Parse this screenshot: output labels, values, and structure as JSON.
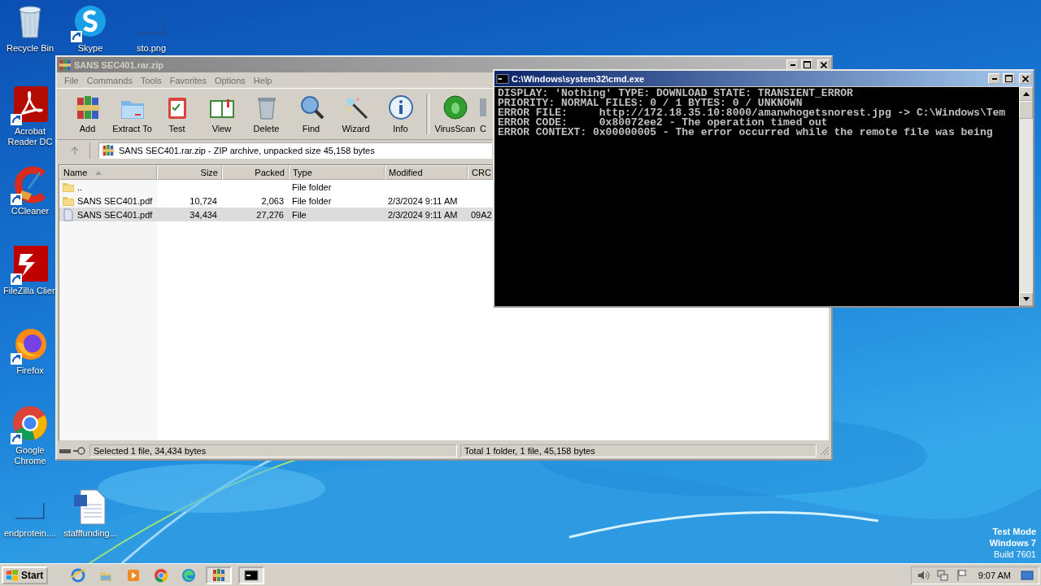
{
  "desktop_icons": [
    {
      "label": "Recycle Bin",
      "kind": "recycle",
      "shortcut": false
    },
    {
      "label": "Skype",
      "kind": "skype",
      "shortcut": true
    },
    {
      "label": "sto.png",
      "kind": "blank",
      "shortcut": false
    },
    {
      "label": "Acrobat Reader DC",
      "kind": "acrobat",
      "shortcut": true
    },
    {
      "label": "CCleaner",
      "kind": "ccleaner",
      "shortcut": true
    },
    {
      "label": "FileZilla Clien",
      "kind": "filezilla",
      "shortcut": true
    },
    {
      "label": "Firefox",
      "kind": "firefox",
      "shortcut": true
    },
    {
      "label": "Google Chrome",
      "kind": "chrome",
      "shortcut": true
    },
    {
      "label": "endprotein....",
      "kind": "blank",
      "shortcut": false
    },
    {
      "label": "stafffunding...",
      "kind": "word",
      "shortcut": false
    }
  ],
  "winrar": {
    "title": "SANS SEC401.rar.zip",
    "menu": [
      "File",
      "Commands",
      "Tools",
      "Favorites",
      "Options",
      "Help"
    ],
    "toolbar": [
      {
        "label": "Add",
        "kind": "add"
      },
      {
        "label": "Extract To",
        "kind": "extract"
      },
      {
        "label": "Test",
        "kind": "test"
      },
      {
        "label": "View",
        "kind": "view"
      },
      {
        "label": "Delete",
        "kind": "delete"
      },
      {
        "label": "Find",
        "kind": "find"
      },
      {
        "label": "Wizard",
        "kind": "wizard"
      },
      {
        "label": "Info",
        "kind": "info"
      },
      {
        "label": "VirusScan",
        "kind": "virus"
      },
      {
        "label": "C",
        "kind": "partial"
      }
    ],
    "address": "SANS SEC401.rar.zip - ZIP archive, unpacked size 45,158 bytes",
    "columns": [
      {
        "label": "Name",
        "sorted": true
      },
      {
        "label": "Size",
        "sorted": false
      },
      {
        "label": "Packed",
        "sorted": false
      },
      {
        "label": "Type",
        "sorted": false
      },
      {
        "label": "Modified",
        "sorted": false
      },
      {
        "label": "CRC"
      }
    ],
    "rows": [
      {
        "kind": "folder",
        "selected": false,
        "cells": [
          "..",
          "",
          "",
          "File folder",
          "",
          ""
        ]
      },
      {
        "kind": "folder",
        "selected": false,
        "cells": [
          "SANS SEC401.pdf",
          "10,724",
          "2,063",
          "File folder",
          "2/3/2024 9:11 AM",
          ""
        ]
      },
      {
        "kind": "file",
        "selected": true,
        "cells": [
          "SANS SEC401.pdf",
          "34,434",
          "27,276",
          "File",
          "2/3/2024 9:11 AM",
          "09A2"
        ]
      }
    ],
    "status_left": "Selected 1 file, 34,434 bytes",
    "status_right": "Total 1 folder, 1 file, 45,158 bytes"
  },
  "cmd": {
    "title": "C:\\Windows\\system32\\cmd.exe",
    "lines": [
      "DISPLAY: 'Nothing' TYPE: DOWNLOAD STATE: TRANSIENT_ERROR",
      "PRIORITY: NORMAL FILES: 0 / 1 BYTES: 0 / UNKNOWN",
      "ERROR FILE:     http://172.18.35.10:8000/amanwhogetsnorest.jpg -> C:\\Windows\\Tem",
      "ERROR CODE:     0x80072ee2 - The operation timed out",
      "ERROR CONTEXT: 0x00000005 - The error occurred while the remote file was being"
    ]
  },
  "os_notice": [
    "Test Mode",
    "Windows 7",
    "Build 7601"
  ],
  "taskbar": {
    "start": "Start",
    "apps": [
      {
        "kind": "ie",
        "active": false
      },
      {
        "kind": "explorer",
        "active": false
      },
      {
        "kind": "media",
        "active": false
      },
      {
        "kind": "chrome",
        "active": false
      },
      {
        "kind": "edge",
        "active": false
      },
      {
        "kind": "winrar",
        "active": true
      },
      {
        "kind": "cmd",
        "active": true
      }
    ],
    "clock": "9:07 AM"
  }
}
